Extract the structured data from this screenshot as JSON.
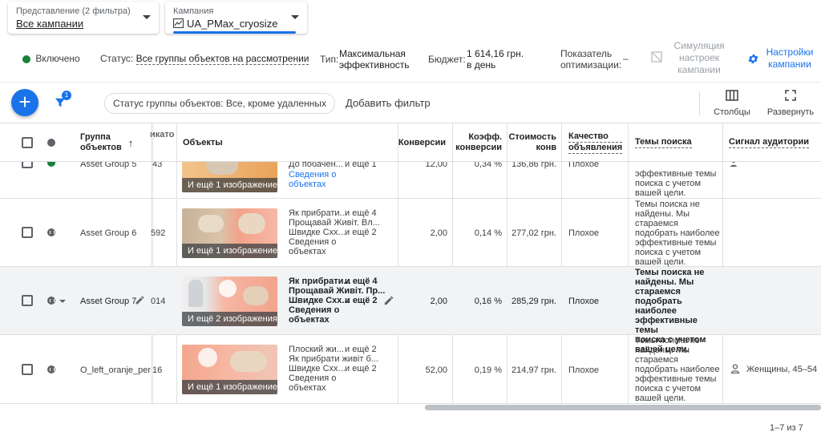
{
  "view_selector": {
    "label": "Представление (2 фильтра)",
    "value": "Все кампании"
  },
  "campaign_selector": {
    "label": "Кампания",
    "value": "UA_PMax_cryosize"
  },
  "info": {
    "status_enabled": "Включено",
    "status_label": "Статус:",
    "status_value": "Все группы объектов на рассмотрении",
    "type_label": "Тип:",
    "type_value_1": "Максимальная",
    "type_value_2": "эффективность",
    "budget_label": "Бюджет:",
    "budget_value_1": "1 614,16 грн.",
    "budget_value_2": "в день",
    "opt_label_1": "Показатель",
    "opt_label_2": "оптимизации:",
    "opt_value": "–",
    "sim_1": "Симуляция",
    "sim_2": "настроек",
    "sim_3": "кампании",
    "settings_1": "Настройки",
    "settings_2": "кампании"
  },
  "toolbar": {
    "filter_badge": "1",
    "filter_chip": "Статус группы объектов: Все, кроме удаленных",
    "add_filter": "Добавить фильтр",
    "columns": "Столбцы",
    "expand": "Развернуть"
  },
  "headers": {
    "group_1": "Группа",
    "group_2": "объектов",
    "partial": "икато",
    "assets": "Объекты",
    "conv": "Конверсии",
    "rate_1": "Коэфф.",
    "rate_2": "конверсии",
    "cost_1": "Стоимость",
    "cost_2": "конв",
    "quality_1": "Качество",
    "quality_2": "объявления",
    "topics": "Темы поиска",
    "signal": "Сигнал аудитории"
  },
  "rows": [
    {
      "name": "Asset Group 5",
      "id_part": "43",
      "caption": "И ещё 1 изображение",
      "h1": "До побачен...",
      "h1m": "и ещё 1",
      "h2": "",
      "h2m": "",
      "h3": "",
      "h3m": "",
      "info_1": "Сведения о",
      "info_2": "объектах",
      "conv": "12,00",
      "rate": "0,34 %",
      "cost": "136,86 грн.",
      "quality": "Плохое",
      "t1": "эффективные темы",
      "t2": "поиска с учетом",
      "t3": "вашей цели.",
      "t4": "",
      "t5": "",
      "t6": "",
      "signal": ""
    },
    {
      "name": "Asset Group 6",
      "id_part": "592",
      "caption": "И ещё 1 изображение",
      "h1": "Як прибрати...",
      "h1m": "и ещё 4",
      "h2": "Прощавай Живіт. Вл...",
      "h2m": "",
      "h3": "Швидке Схх...",
      "h3m": "и ещё 2",
      "info_1": "Сведения о",
      "info_2": "объектах",
      "conv": "2,00",
      "rate": "0,14 %",
      "cost": "277,02 грн.",
      "quality": "Плохое",
      "t1": "Темы поиска не",
      "t2": "найдены. Мы",
      "t3": "стараемся",
      "t4": "подобрать наиболее",
      "t5": "эффективные темы",
      "t6": "поиска с учетом",
      "t7": "вашей цели.",
      "signal": ""
    },
    {
      "name": "Asset Group 7",
      "id_part": "014",
      "caption": "И ещё 2 изображения",
      "h1": "Як прибрати...",
      "h1m": "и ещё 4",
      "h2": "Прощавай Живіт. Пр...",
      "h2m": "",
      "h3": "Швидке Схх...",
      "h3m": "и ещё 2",
      "info_1": "Сведения о",
      "info_2": "объектах",
      "conv": "2,00",
      "rate": "0,16 %",
      "cost": "285,29 грн.",
      "quality": "Плохое",
      "t1": "Темы поиска не",
      "t2": "найдены. Мы",
      "t3": "стараемся",
      "t4": "подобрать наиболее",
      "t5": "эффективные темы",
      "t6": "поиска с учетом",
      "t7": "вашей цели.",
      "signal": ""
    },
    {
      "name": "O_left_oranje_percib",
      "id_part": "16",
      "caption": "И ещё 1 изображение",
      "h1": "Плоский жи...",
      "h1m": "и ещё 2",
      "h2": "Як прибрати живіт б...",
      "h2m": "",
      "h3": "Швидке Схх...",
      "h3m": "и ещё 2",
      "info_1": "Сведения о",
      "info_2": "объектах",
      "conv": "52,00",
      "rate": "0,19 %",
      "cost": "214,97 грн.",
      "quality": "Плохое",
      "t1": "Темы поиска не",
      "t2": "найдены. Мы",
      "t3": "стараемся",
      "t4": "подобрать наиболее",
      "t5": "эффективные темы",
      "t6": "поиска с учетом",
      "t7": "вашей цели.",
      "signal": "Женщины, 45–54"
    }
  ],
  "pagination": "1–7 из 7",
  "colors": {
    "accent": "#1a73e8",
    "enabled": "#188038"
  }
}
